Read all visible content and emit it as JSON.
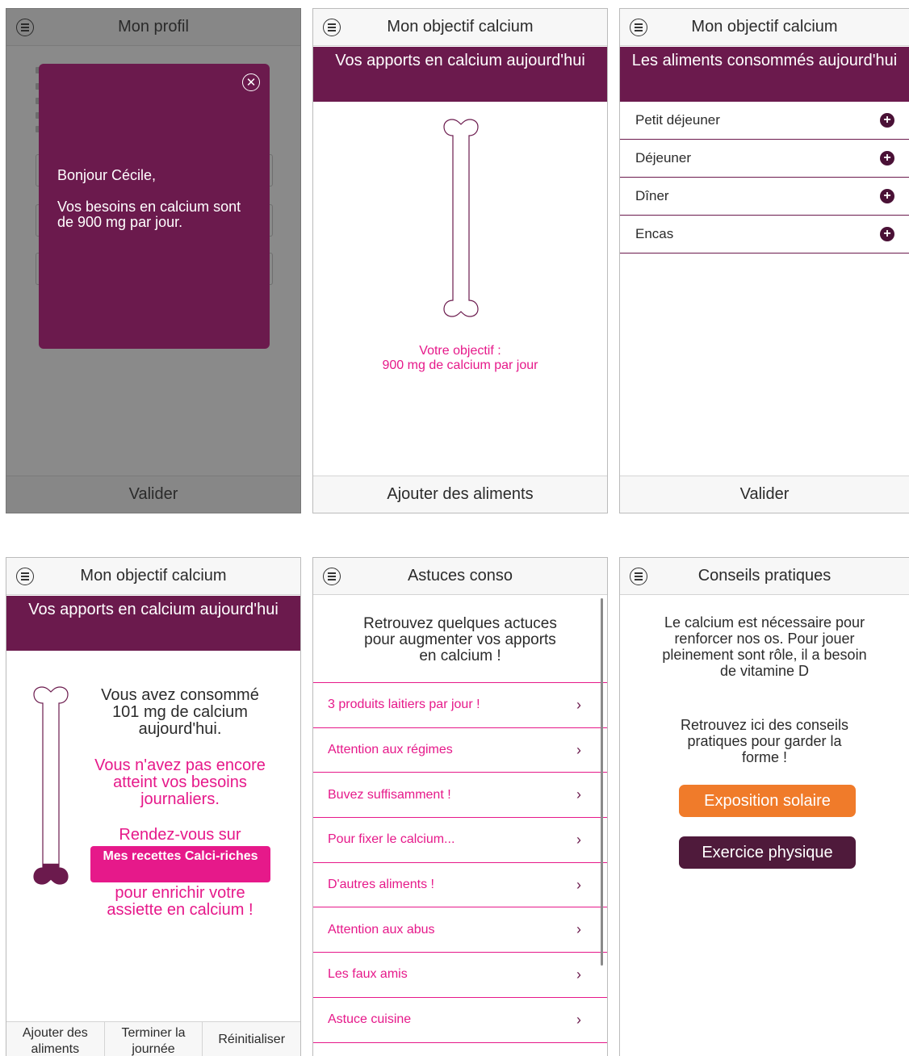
{
  "colors": {
    "plum": "#6b1a4d",
    "pink": "#e6198a",
    "orange": "#f07b2a",
    "dark_plum": "#4f1a3b",
    "overlay_gray": "#8a8a8a"
  },
  "screen1": {
    "title": "Mon profil",
    "menu_icon": "menu-lines-circle-icon",
    "modal": {
      "greeting": "Bonjour Cécile,",
      "message": "Vos besoins en calcium sont de 900 mg par jour.",
      "close_icon": "close-circle-icon"
    },
    "footer": "Valider"
  },
  "screen2": {
    "title": "Mon objectif calcium",
    "banner": "Vos apports en calcium aujourd'hui",
    "objective_line1": "Votre objectif :",
    "objective_line2": "900 mg de calcium par jour",
    "bone_fill": 0,
    "footer": "Ajouter des aliments"
  },
  "screen3": {
    "title": "Mon objectif calcium",
    "banner": "Les aliments consommés aujourd'hui",
    "meals": [
      {
        "label": "Petit déjeuner"
      },
      {
        "label": "Déjeuner"
      },
      {
        "label": "Dîner"
      },
      {
        "label": "Encas"
      }
    ],
    "footer": "Valider"
  },
  "screen4": {
    "title": "Mon objectif calcium",
    "banner": "Vos apports en calcium aujourd'hui",
    "consumed": "Vous avez consommé 101 mg de calcium aujourd'hui.",
    "not_reached": "Vous n'avez pas encore atteint vos besoins journaliers.",
    "goto": "Rendez-vous sur",
    "recipe_button": "Mes recettes Calci-riches",
    "enrich": "pour enrichir votre assiette en calcium !",
    "bone_fill": 0.11,
    "tabs": [
      "Ajouter des aliments",
      "Terminer la journée",
      "Réinitialiser"
    ]
  },
  "screen5": {
    "title": "Astuces conso",
    "intro": "Retrouvez quelques actuces pour augmenter vos apports en calcium !",
    "tips": [
      "3 produits laitiers par jour !",
      "Attention aux régimes",
      "Buvez suffisamment !",
      "Pour fixer le calcium...",
      "D'autres aliments !",
      "Attention aux abus",
      "Les faux amis",
      "Astuce cuisine"
    ]
  },
  "screen6": {
    "title": "Conseils pratiques",
    "text1": "Le calcium est nécessaire pour renforcer nos os. Pour jouer pleinement sont rôle, il a besoin de vitamine D",
    "text2": "Retrouvez ici des conseils pratiques pour garder la forme !",
    "button_sun": "Exposition solaire",
    "button_sport": "Exercice physique"
  }
}
